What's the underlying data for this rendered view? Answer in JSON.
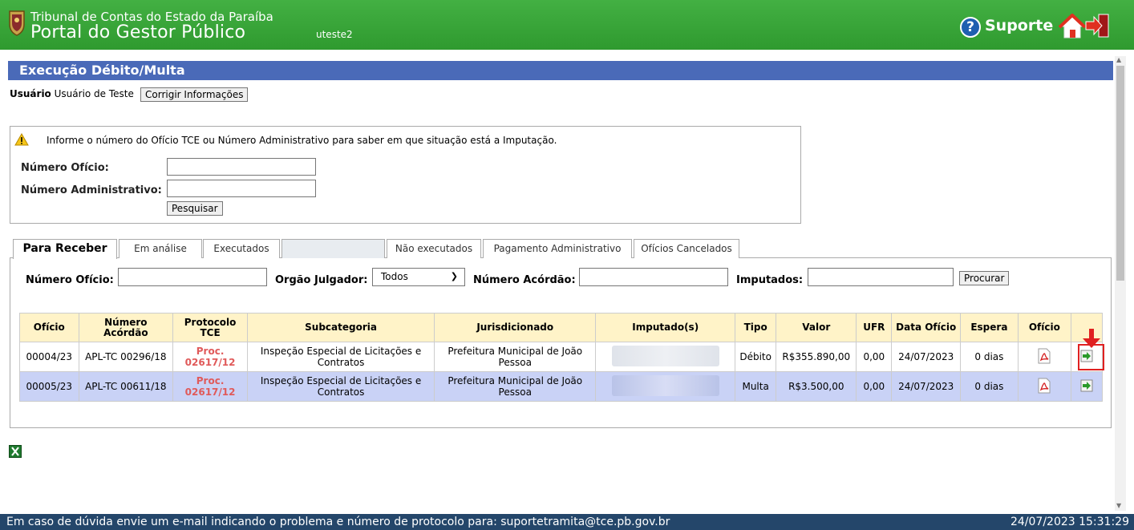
{
  "header": {
    "org_line1": "Tribunal de Contas do Estado da Paraíba",
    "org_line2": "Portal do Gestor Público",
    "username": "uteste2",
    "support_label": "Suporte",
    "help_glyph": "?"
  },
  "page_title": "Execução Débito/Multa",
  "user_info": {
    "label": "Usuário",
    "name": "Usuário de Teste",
    "correct_button": "Corrigir Informações"
  },
  "search": {
    "info_text": "Informe o número do Ofício TCE ou Número Administrativo para saber em que situação está a Imputação.",
    "numero_oficio_label": "Número Ofício:",
    "numero_oficio_value": "",
    "numero_administrativo_label": "Número Administrativo:",
    "numero_administrativo_value": "",
    "search_button": "Pesquisar"
  },
  "tabs": [
    {
      "label": "Para Receber",
      "active": true
    },
    {
      "label": "Em análise"
    },
    {
      "label": "Executados"
    },
    {
      "label": ""
    },
    {
      "label": "Não executados"
    },
    {
      "label": "Pagamento Administrativo"
    },
    {
      "label": "Ofícios Cancelados"
    }
  ],
  "filters": {
    "numero_oficio_label": "Número Ofício:",
    "orgao_julgador_label": "Orgão Julgador:",
    "orgao_julgador_value": "Todos",
    "numero_acordao_label": "Número Acórdão:",
    "imputados_label": "Imputados:",
    "search_button": "Procurar"
  },
  "table": {
    "headers": {
      "oficio": "Ofício",
      "numero_acordao": "Número Acórdão",
      "protocolo_tce": "Protocolo TCE",
      "subcategoria": "Subcategoria",
      "jurisdicionado": "Jurisdicionado",
      "imputados": "Imputado(s)",
      "tipo": "Tipo",
      "valor": "Valor",
      "ufr": "UFR",
      "data_oficio": "Data Ofício",
      "espera": "Espera",
      "oficio_doc": "Ofício"
    },
    "rows": [
      {
        "oficio": "00004/23",
        "numero_acordao": "APL-TC 00296/18",
        "protocolo_line1": "Proc.",
        "protocolo_line2": "02617/12",
        "subcategoria": "Inspeção Especial de Licitações e Contratos",
        "jurisdicionado": "Prefeitura Municipal de João Pessoa",
        "tipo": "Débito",
        "valor": "R$355.890,00",
        "ufr": "0,00",
        "data_oficio": "24/07/2023",
        "espera": "0 dias"
      },
      {
        "oficio": "00005/23",
        "numero_acordao": "APL-TC 00611/18",
        "protocolo_line1": "Proc.",
        "protocolo_line2": "02617/12",
        "subcategoria": "Inspeção Especial de Licitações e Contratos",
        "jurisdicionado": "Prefeitura Municipal de João Pessoa",
        "tipo": "Multa",
        "valor": "R$3.500,00",
        "ufr": "0,00",
        "data_oficio": "24/07/2023",
        "espera": "0 dias"
      }
    ]
  },
  "footer": {
    "message": "Em caso de dúvida envie um e-mail indicando o problema e número de protocolo para: suportetramita@tce.pb.gov.br",
    "datetime": "24/07/2023 15:31:29"
  },
  "colors": {
    "header_green": "#3aa63a",
    "title_blue": "#4a6ab8",
    "footer_navy": "#24466a",
    "row_highlight": "#c9d2f6",
    "table_header": "#fff3c8",
    "protocol_red": "#e05a5a",
    "annotation_red": "#e02020"
  },
  "icons": {
    "crest": "crest-icon",
    "help": "help-icon",
    "home": "home-icon",
    "exit": "exit-icon",
    "warning": "warning-icon",
    "pdf": "pdf-icon",
    "go": "go-icon",
    "excel": "excel-icon",
    "annotation": "red-arrow-icon"
  }
}
